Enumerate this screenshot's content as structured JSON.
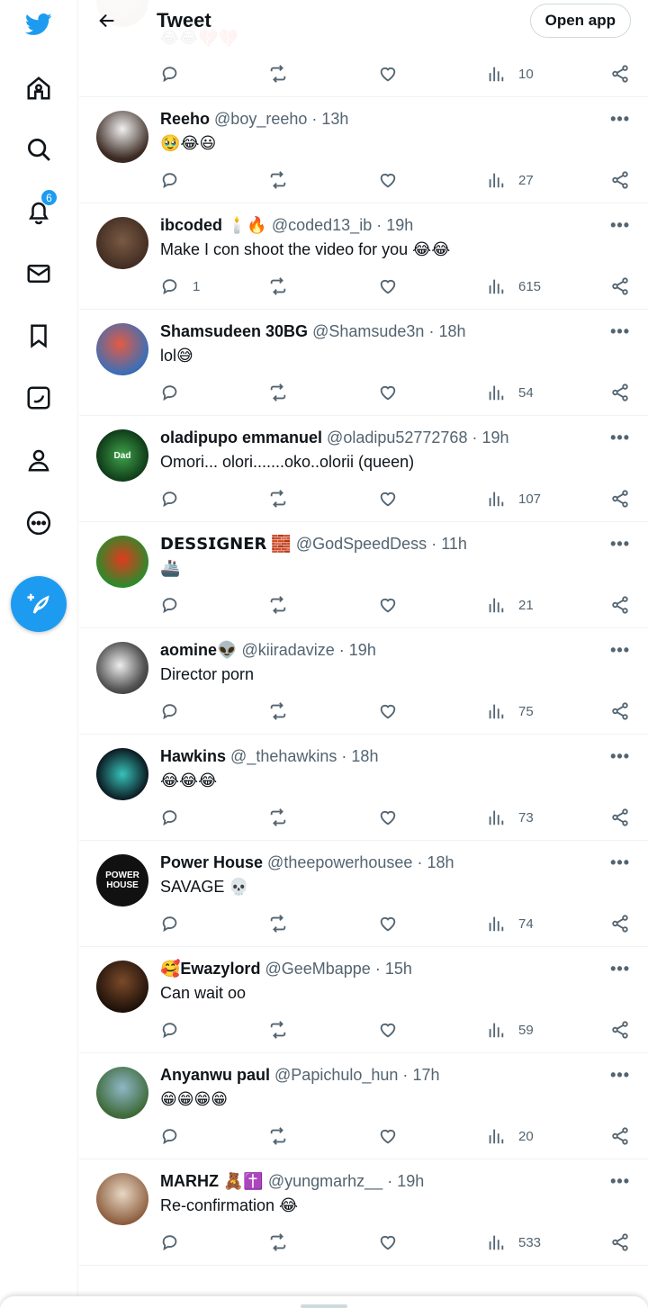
{
  "header": {
    "title": "Tweet",
    "open_app_label": "Open app",
    "back_icon": "arrow-left-icon"
  },
  "sidebar": {
    "items": [
      {
        "icon": "twitter-bird-icon",
        "name": "logo"
      },
      {
        "icon": "home-icon",
        "name": "home"
      },
      {
        "icon": "search-icon",
        "name": "explore"
      },
      {
        "icon": "bell-icon",
        "name": "notifications",
        "badge": "6"
      },
      {
        "icon": "mail-icon",
        "name": "messages"
      },
      {
        "icon": "bookmark-icon",
        "name": "bookmarks"
      },
      {
        "icon": "twitter-blue-icon",
        "name": "twitter-blue"
      },
      {
        "icon": "person-icon",
        "name": "profile"
      },
      {
        "icon": "more-circle-icon",
        "name": "more"
      }
    ],
    "compose_icon": "feather-plus-icon"
  },
  "colors": {
    "accent": "#1d9bf0",
    "text": "#0f1419",
    "secondary": "#536471",
    "border": "#eff3f4"
  },
  "tweets": [
    {
      "name": "",
      "handle": "",
      "time": "",
      "text": "😂😂💔💔",
      "replies": "",
      "views": "10"
    },
    {
      "name": "Reeho",
      "handle": "@boy_reeho",
      "time": "13h",
      "text": "🥹😂😃",
      "replies": "",
      "views": "27"
    },
    {
      "name": "ibcoded 🕯️🔥",
      "handle": "@coded13_ib",
      "time": "19h",
      "text": "Make I con shoot the video for you 😂😂",
      "replies": "1",
      "views": "615"
    },
    {
      "name": "Shamsudeen 30BG",
      "handle": "@Shamsude3n",
      "time": "18h",
      "text": "lol😅",
      "replies": "",
      "views": "54"
    },
    {
      "name": "oladipupo emmanuel",
      "handle": "@oladipu52772768",
      "time": "19h",
      "text": "Omori... olori.......oko..olorii (queen)",
      "replies": "",
      "views": "107",
      "avatar_text": "Dad"
    },
    {
      "name": "𝗗𝗘𝗦𝗦𝗜𝗚𝗡𝗘𝗥 🧱",
      "handle": "@GodSpeedDess",
      "time": "11h",
      "text": "🚢",
      "replies": "",
      "views": "21"
    },
    {
      "name": "aomine👽",
      "handle": "@kiiradavize",
      "time": "19h",
      "text": "Director porn",
      "replies": "",
      "views": "75"
    },
    {
      "name": "Hawkins",
      "handle": "@_thehawkins",
      "time": "18h",
      "text": "😂😂😂",
      "replies": "",
      "views": "73"
    },
    {
      "name": "Power House",
      "handle": "@theepowerhousee",
      "time": "18h",
      "text": "SAVAGE 💀",
      "replies": "",
      "views": "74",
      "avatar_text": "POWER HOUSE"
    },
    {
      "name": "🥰Ewazylord",
      "handle": "@GeeMbappe",
      "time": "15h",
      "text": "Can wait oo",
      "replies": "",
      "views": "59"
    },
    {
      "name": "Anyanwu paul",
      "handle": "@Papichulo_hun",
      "time": "17h",
      "text": "😁😁😁😁",
      "replies": "",
      "views": "20"
    },
    {
      "name": "MARHZ 🧸✝️",
      "handle": "@yungmarhz__",
      "time": "19h",
      "text": "Re-confirmation 😂",
      "replies": "",
      "views": "533"
    }
  ]
}
